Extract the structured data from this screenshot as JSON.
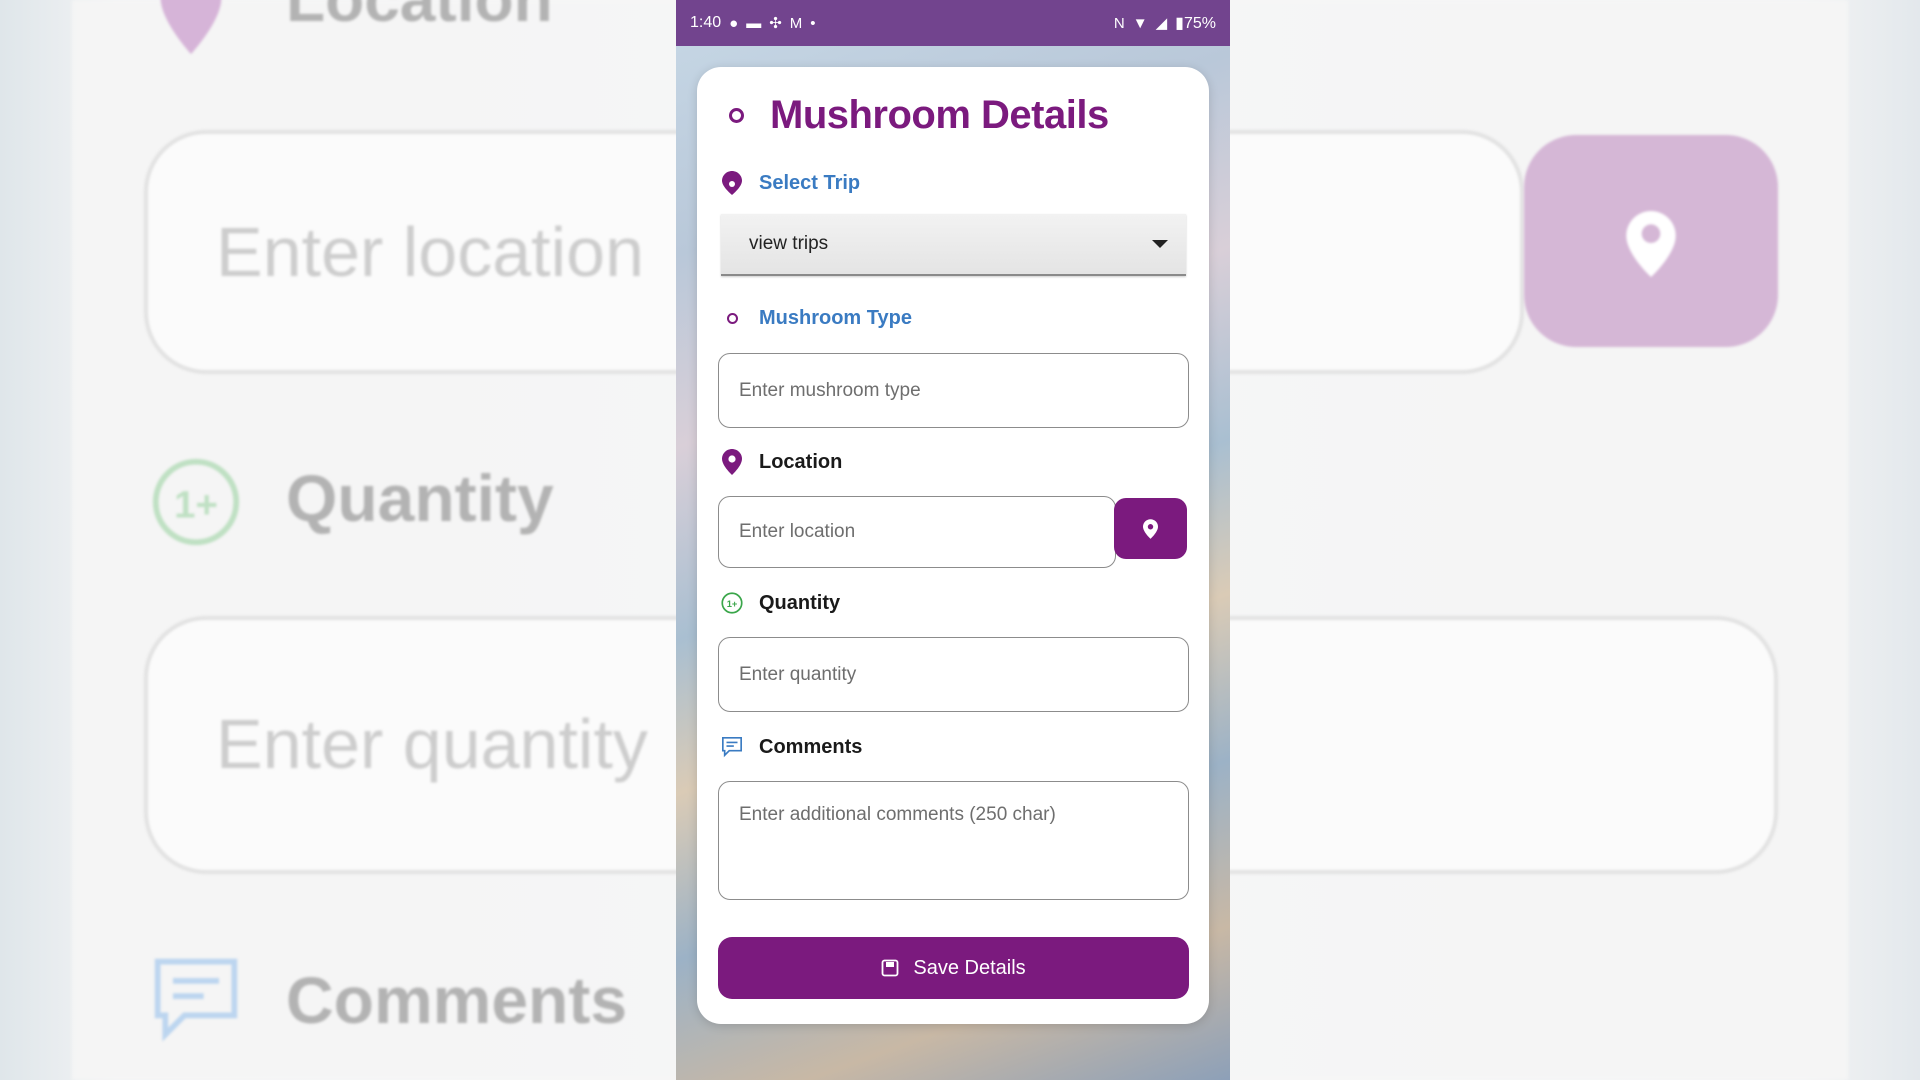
{
  "statusbar": {
    "time": "1:40",
    "battery": "75%"
  },
  "form": {
    "title": "Mushroom Details",
    "trip": {
      "label": "Select Trip",
      "selected": "view trips"
    },
    "mushroom_type": {
      "label": "Mushroom Type",
      "placeholder": "Enter mushroom type"
    },
    "location": {
      "label": "Location",
      "placeholder": "Enter location"
    },
    "quantity": {
      "label": "Quantity",
      "placeholder": "Enter quantity"
    },
    "comments": {
      "label": "Comments",
      "placeholder": "Enter additional comments (250 char)"
    },
    "save_label": "Save Details"
  },
  "colors": {
    "primary": "#7b1a7e",
    "statusbar": "#72448e",
    "label_blue": "#3a7bc2",
    "quantity_green": "#3aa64a"
  },
  "icons": {
    "title": "ring-icon",
    "trip": "pin-icon",
    "mushroom_type": "ring-icon",
    "location": "map-pin-icon",
    "quantity": "plus-one-icon",
    "comments": "comment-icon",
    "location_button": "map-pin-icon",
    "save": "save-icon"
  }
}
